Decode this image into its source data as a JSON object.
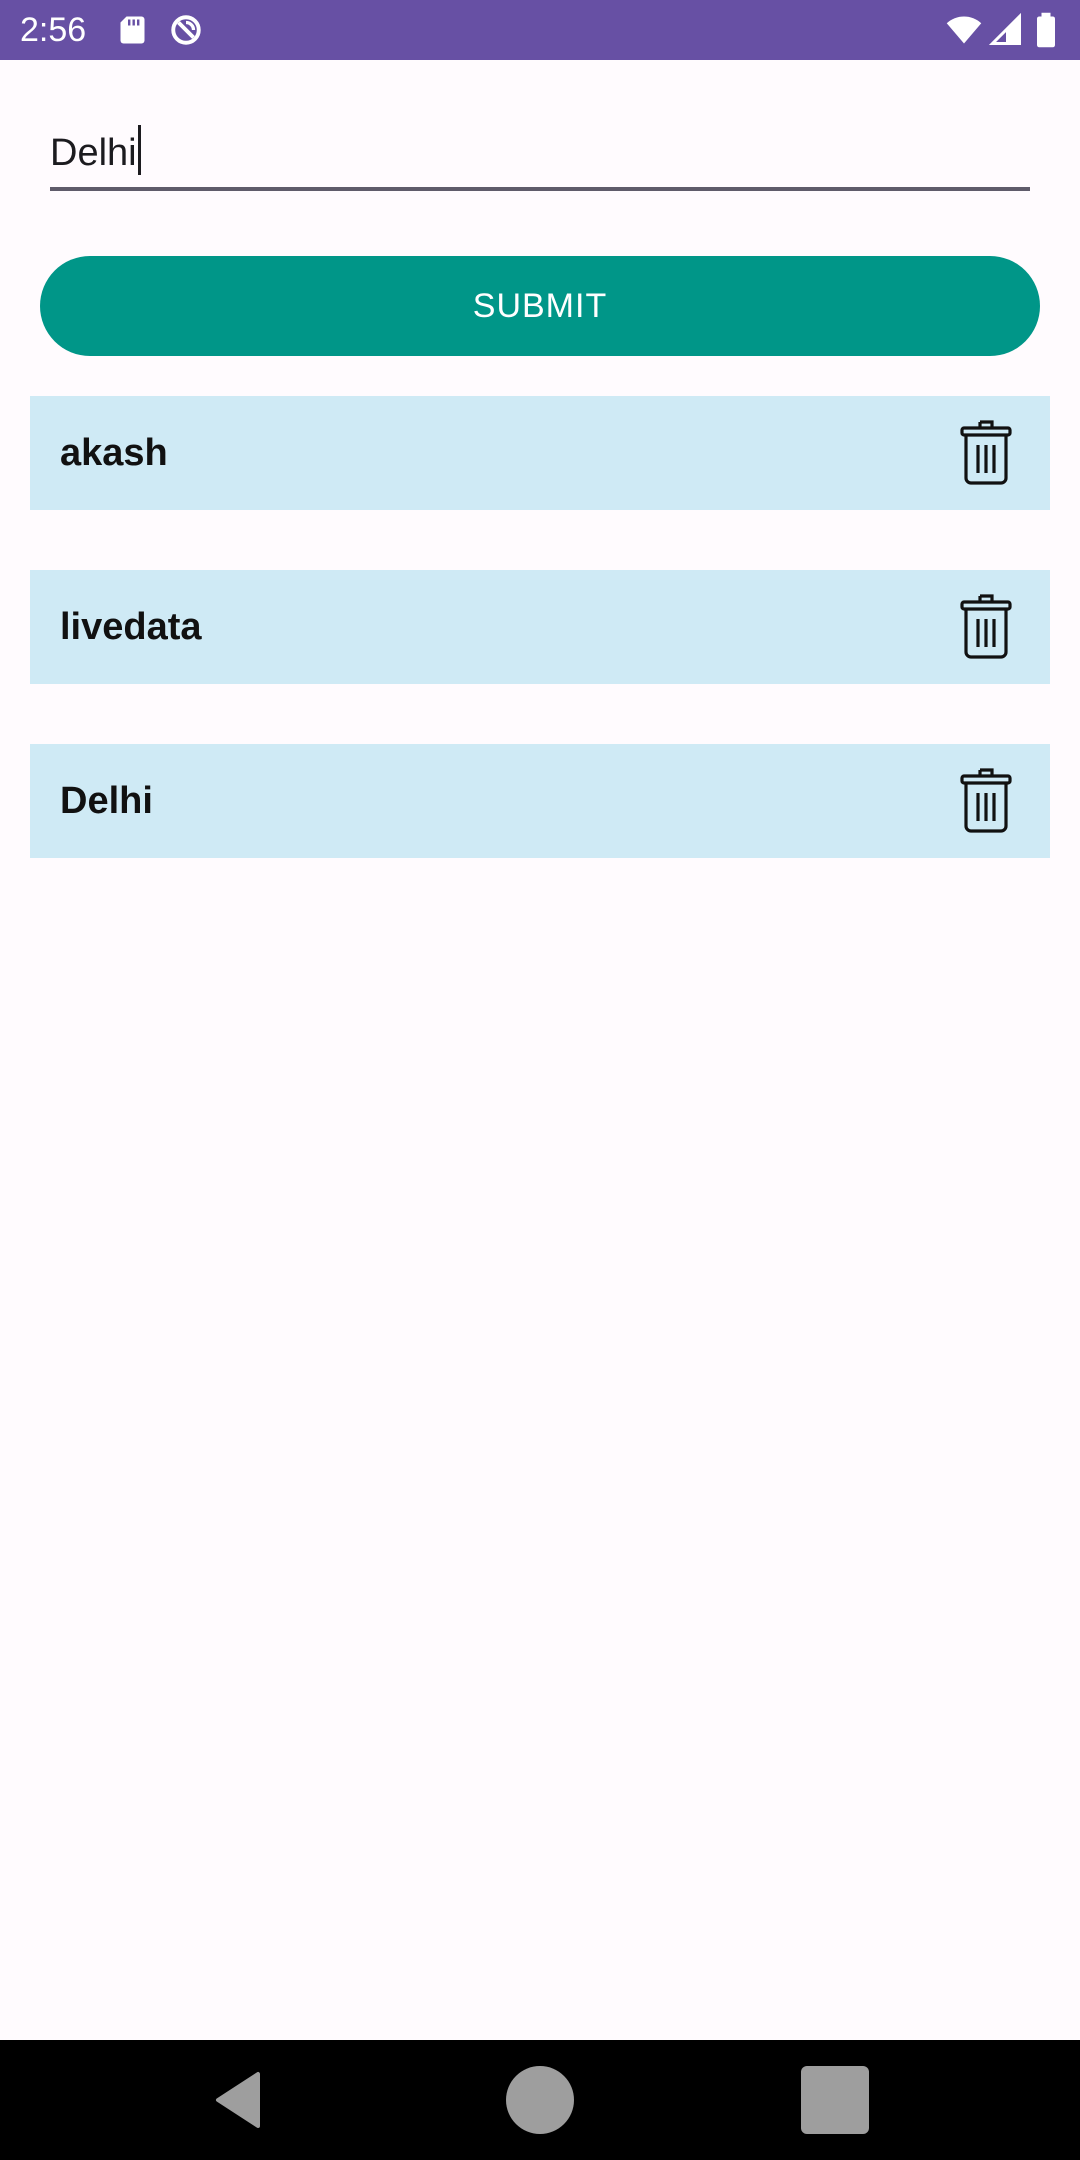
{
  "status_bar": {
    "time": "2:56",
    "icons": [
      "sd-card-icon",
      "sync-disabled-icon",
      "wifi-icon",
      "signal-icon",
      "battery-icon"
    ],
    "background": "#6750a4"
  },
  "input": {
    "value": "Delhi",
    "placeholder": ""
  },
  "submit": {
    "label": "SUBMIT",
    "color": "#009688"
  },
  "list": {
    "item_color": "#cfeaf5",
    "items": [
      {
        "label": "akash",
        "action_icon": "trash-icon"
      },
      {
        "label": "livedata",
        "action_icon": "trash-icon"
      },
      {
        "label": "Delhi",
        "action_icon": "trash-icon"
      }
    ]
  },
  "nav_bar": {
    "buttons": [
      "back-icon",
      "home-icon",
      "recents-icon"
    ]
  }
}
